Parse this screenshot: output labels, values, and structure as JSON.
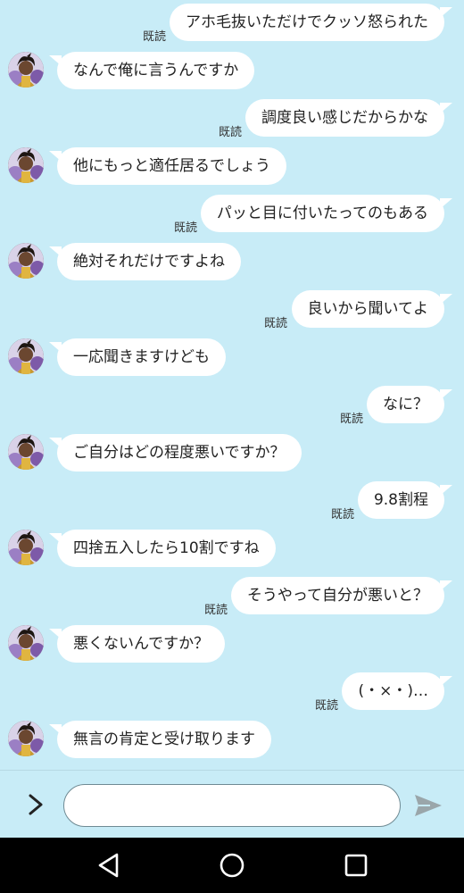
{
  "read_label": "既読",
  "messages": [
    {
      "side": "sent",
      "text": "アホ毛抜いただけでクッソ怒られた"
    },
    {
      "side": "recv",
      "text": "なんで俺に言うんですか"
    },
    {
      "side": "sent",
      "text": "調度良い感じだからかな"
    },
    {
      "side": "recv",
      "text": "他にもっと適任居るでしょう"
    },
    {
      "side": "sent",
      "text": "パッと目に付いたってのもある"
    },
    {
      "side": "recv",
      "text": "絶対それだけですよね"
    },
    {
      "side": "sent",
      "text": "良いから聞いてよ"
    },
    {
      "side": "recv",
      "text": "一応聞きますけども"
    },
    {
      "side": "sent",
      "text": "なに？"
    },
    {
      "side": "recv",
      "text": "ご自分はどの程度悪いですか？"
    },
    {
      "side": "sent",
      "text": "9.8割程"
    },
    {
      "side": "recv",
      "text": "四捨五入したら10割ですね"
    },
    {
      "side": "sent",
      "text": "そうやって自分が悪いと？"
    },
    {
      "side": "recv",
      "text": "悪くないんですか？"
    },
    {
      "side": "sent",
      "text": "(・×・)…"
    },
    {
      "side": "recv",
      "text": "無言の肯定と受け取ります"
    }
  ],
  "composer": {
    "input_value": "",
    "expand_icon": "chevron-right-icon",
    "send_icon": "send-icon"
  },
  "navbar": {
    "back_icon": "back-triangle-icon",
    "home_icon": "home-circle-icon",
    "recents_icon": "recents-square-icon"
  },
  "colors": {
    "background": "#c8ecf7",
    "bubble": "#ffffff",
    "navbar": "#000000",
    "send_icon": "#9aa6aa"
  }
}
